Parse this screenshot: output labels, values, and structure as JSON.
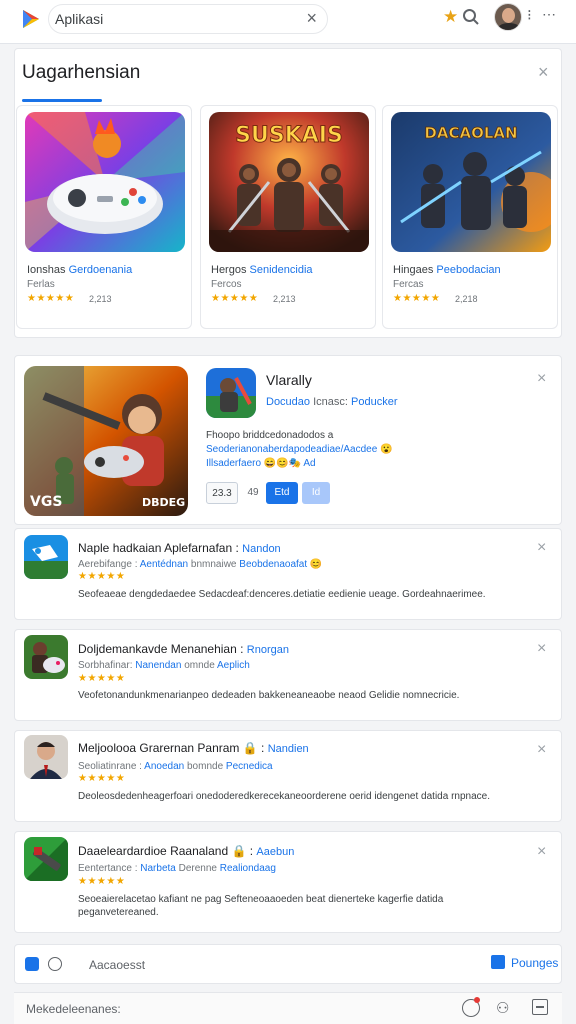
{
  "header": {
    "search_value": "Aplikasi",
    "clear_icon": "close-icon",
    "star_icon": "star-icon",
    "search_icon": "search-icon",
    "dots_label": "⁝",
    "more_label": "⋯"
  },
  "featured_section": {
    "title": "Uagarhensian",
    "cards": [
      {
        "name_a": "Ionshas",
        "name_b": "Gerdoenania",
        "sub": "Ferlas",
        "stars": "★★★★★",
        "count": "2,213"
      },
      {
        "name_a": "Hergos",
        "name_b": "Senidencidia",
        "sub": "Fercos",
        "stars": "★★★★★",
        "count": "2,213"
      },
      {
        "name_a": "Hingaes",
        "name_b": "Peebodacian",
        "sub": "Fercas",
        "stars": "★★★★★",
        "count": "2,218"
      }
    ],
    "card_art_titles": [
      "",
      "SUSKAIS",
      "DACAOLAN"
    ]
  },
  "feature_item": {
    "title": "Vlarally",
    "dev_a": "Docudao",
    "dev_b": "Icnasc:",
    "dev_c": "Poducker",
    "desc1": "Fhoopo briddcedonadodos a",
    "desc2": "Seoderianonaberdapodeadiae/Aacdee 😮",
    "desc3": "Illsaderfaero 😄😊🎭 Ad",
    "chip_a": "23.3",
    "chip_b": "49",
    "chip_c": "Etd",
    "chip_d": "Id",
    "art_left": "VGS",
    "art_right": "DBDEG"
  },
  "list_items": [
    {
      "title": "Naple hadkaian Aplefarnafan :",
      "title_link": "Nandon",
      "sub_a": "Aerebifange :",
      "sub_b": "Aentédnan",
      "sub_c": "bnmnaiwe",
      "sub_d": "Beobdenaoafat 😊",
      "stars": "★★★★★",
      "desc": "Seofeaeae dengdedaedee Sedacdeaf:denceres.detiatie eedienie ueage. Gordeahnaerimee."
    },
    {
      "title": "Doljdemankavde Menanehian :",
      "title_link": "Rnorgan",
      "sub_a": "Sorbhafinar:",
      "sub_b": "Nanendan",
      "sub_c": "omnde",
      "sub_d": "Aeplich",
      "stars": "★★★★★",
      "desc": "Veofetonandunkmenarianpeo dedeaden bakkeneaneaobe neaod Gelidie nomnecricie."
    },
    {
      "title": "Meljoolooa Grarernan Panram 🔒 :",
      "title_link": "Nandien",
      "sub_a": "Seoliatinrane :",
      "sub_b": "Anoedan",
      "sub_c": "bomnde",
      "sub_d": "Pecnedica",
      "stars": "★★★★★",
      "desc": "Deoleosdedenheagerfoari onedoderedkerecekaneoorderene oerid idengenet datida rnpnace."
    },
    {
      "title": "Daaeleardardioe Raanaland 🔒 :",
      "title_link": "Aaebun",
      "sub_a": "Eentertance :",
      "sub_b": "Narbeta",
      "sub_c": "Derenne",
      "sub_d": "Realiondaag",
      "stars": "★★★★★",
      "desc": "Seoeaierelacetao kafiant ne pag Sefteneoaaoeden beat dienerteke kagerfie datida peganvetereaned."
    }
  ],
  "bottom_bar": {
    "input_text": "Aacaoesst",
    "button_label": "Pounges"
  },
  "footer": {
    "text": "Mekedeleenanes:"
  },
  "colors": {
    "accent": "#1a73e8",
    "star": "#f2a600",
    "notification": "#e53935"
  }
}
